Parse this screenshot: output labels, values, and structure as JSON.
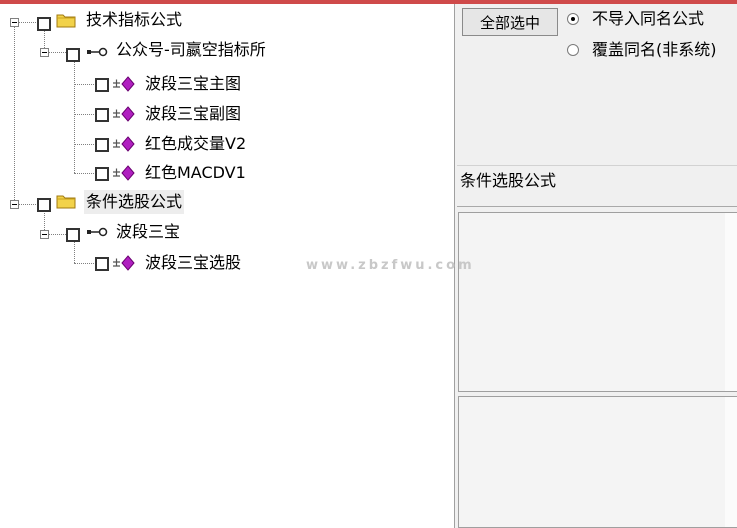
{
  "tree": {
    "groups": [
      {
        "label": "技术指标公式",
        "children": [
          {
            "label": "公众号-司嬴空指标所",
            "items": [
              "波段三宝主图",
              "波段三宝副图",
              "红色成交量V2",
              "红色MACDV1"
            ]
          }
        ]
      },
      {
        "label": "条件选股公式",
        "children": [
          {
            "label": "波段三宝",
            "items": [
              "波段三宝选股"
            ]
          }
        ]
      }
    ]
  },
  "options": {
    "select_all_label": "全部选中",
    "radio_no_import": "不导入同名公式",
    "radio_overwrite": "覆盖同名(非系统)",
    "selected_radio": "no_import"
  },
  "detail": {
    "section_label": "条件选股公式"
  },
  "watermark": "www.zbzfwu.com",
  "colors": {
    "top_bar": "#cf4a4a",
    "formula_icon": "#b020c0",
    "folder_icon": "#f2d24a"
  }
}
